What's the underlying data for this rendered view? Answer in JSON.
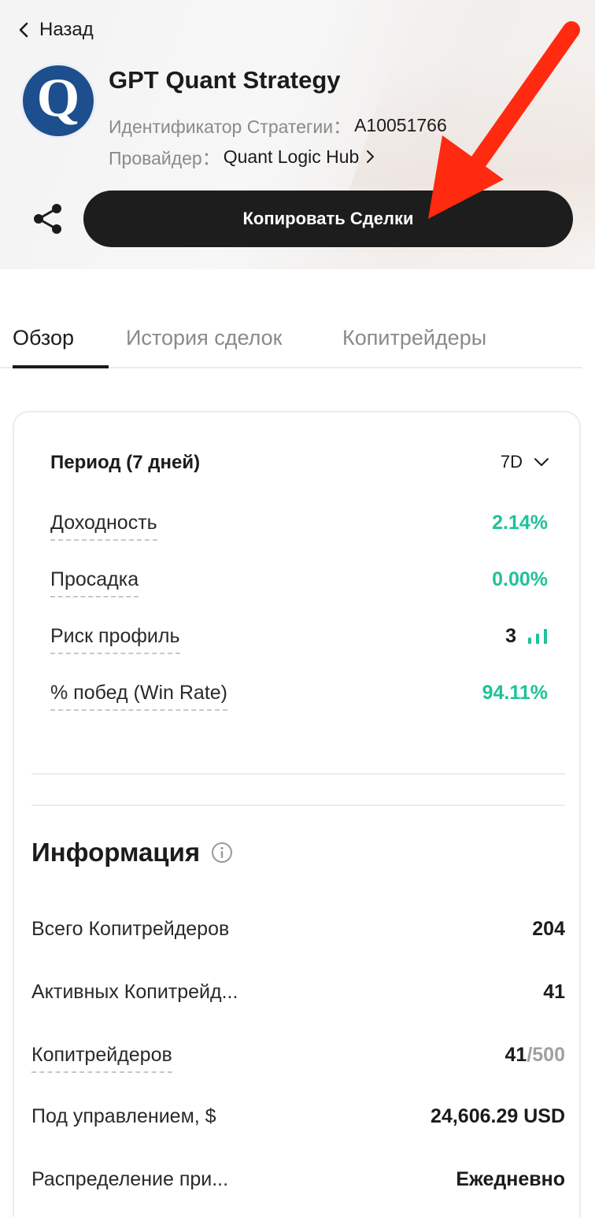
{
  "header": {
    "back_label": "Назад",
    "logo_letter": "Q",
    "strategy_name": "GPT Quant Strategy",
    "id_key": "Идентификатор Стратегии：",
    "id_value": "A10051766",
    "provider_key": "Провайдер：",
    "provider_value": "Quant Logic Hub",
    "copy_button": "Копировать Сделки",
    "share_icon": "share-icon"
  },
  "tabs": [
    {
      "label": "Обзор",
      "active": true
    },
    {
      "label": "История сделок",
      "active": false
    },
    {
      "label": "Копитрейдеры",
      "active": false
    }
  ],
  "period": {
    "title": "Период (7 дней)",
    "selected": "7D"
  },
  "metrics": [
    {
      "label": "Доходность",
      "value": "2.14%"
    },
    {
      "label": "Просадка",
      "value": "0.00%"
    },
    {
      "label": "Риск профиль",
      "value": "3"
    },
    {
      "label": "% побед (Win Rate)",
      "value": "94.11%"
    }
  ],
  "info": {
    "title": "Информация",
    "rows": [
      {
        "label": "Всего Копитрейдеров",
        "value": "204"
      },
      {
        "label": "Активных Копитрейд...",
        "value": "41"
      },
      {
        "label": "Копитрейдеров",
        "value": "41",
        "value_suffix": "/500"
      },
      {
        "label": "Под управлением, $",
        "value": "24,606.29 USD"
      },
      {
        "label": "Распределение при...",
        "value": "Ежедневно"
      }
    ]
  },
  "colors": {
    "accent_green": "#1fc29a",
    "button_dark": "#1d1d1d",
    "logo_blue": "#1d4f8f",
    "arrow_red": "#ff2a10"
  }
}
